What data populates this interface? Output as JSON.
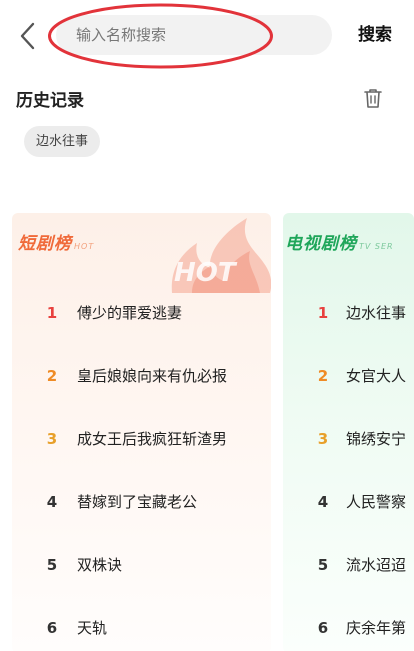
{
  "search": {
    "placeholder": "输入名称搜索",
    "button_label": "搜索"
  },
  "history": {
    "title": "历史记录",
    "items": [
      "边水往事"
    ]
  },
  "short_drama": {
    "title": "短剧榜",
    "subtitle": "HOT",
    "badge_text": "HOT",
    "items": [
      {
        "rank": "1",
        "name": "傅少的罪爱逃妻"
      },
      {
        "rank": "2",
        "name": "皇后娘娘向来有仇必报"
      },
      {
        "rank": "3",
        "name": "成女王后我疯狂斩渣男"
      },
      {
        "rank": "4",
        "name": "替嫁到了宝藏老公"
      },
      {
        "rank": "5",
        "name": "双株诀"
      },
      {
        "rank": "6",
        "name": "天轨"
      }
    ]
  },
  "tv_drama": {
    "title": "电视剧榜",
    "subtitle": "TV SER",
    "items": [
      {
        "rank": "1",
        "name": "边水往事"
      },
      {
        "rank": "2",
        "name": "女官大人"
      },
      {
        "rank": "3",
        "name": "锦绣安宁"
      },
      {
        "rank": "4",
        "name": "人民警察"
      },
      {
        "rank": "5",
        "name": "流水迢迢"
      },
      {
        "rank": "6",
        "name": "庆余年第"
      }
    ]
  },
  "colors": {
    "rank_1": "#e8413e",
    "rank_2": "#ef8b25",
    "rank_3": "#e8a02a",
    "short_title": "#f06a3a",
    "tv_title": "#1fa65a",
    "annotation_circle": "#e2333a"
  },
  "icons": {
    "back": "chevron-left-icon",
    "delete": "trash-icon",
    "badge": "flame-icon"
  }
}
